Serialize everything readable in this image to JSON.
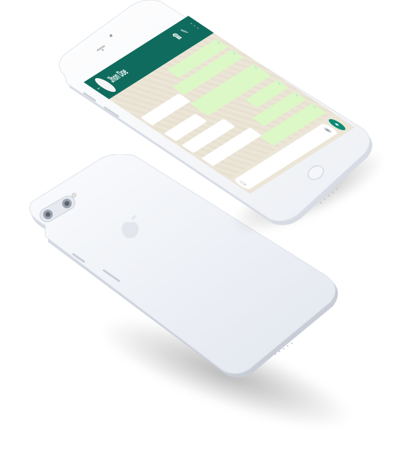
{
  "chat": {
    "contact_name": "Jhon Doe",
    "back_icon": "arrow-left-icon",
    "call_icon": "phone-icon",
    "attach_icon": "paperclip-icon",
    "menu_icon": "more-vertical-icon",
    "emoji_icon": "smiley-icon",
    "camera_icon": "camera-icon",
    "mic_icon": "microphone-icon",
    "read_tick": "✓"
  },
  "colors": {
    "header": "#0f6b5d",
    "incoming_bubble": "#ffffff",
    "outgoing_bubble": "#dcf8c6",
    "wallpaper": "#ede8dc",
    "mic_button": "#0f8a74",
    "phone_body": "#f2f4f8"
  }
}
